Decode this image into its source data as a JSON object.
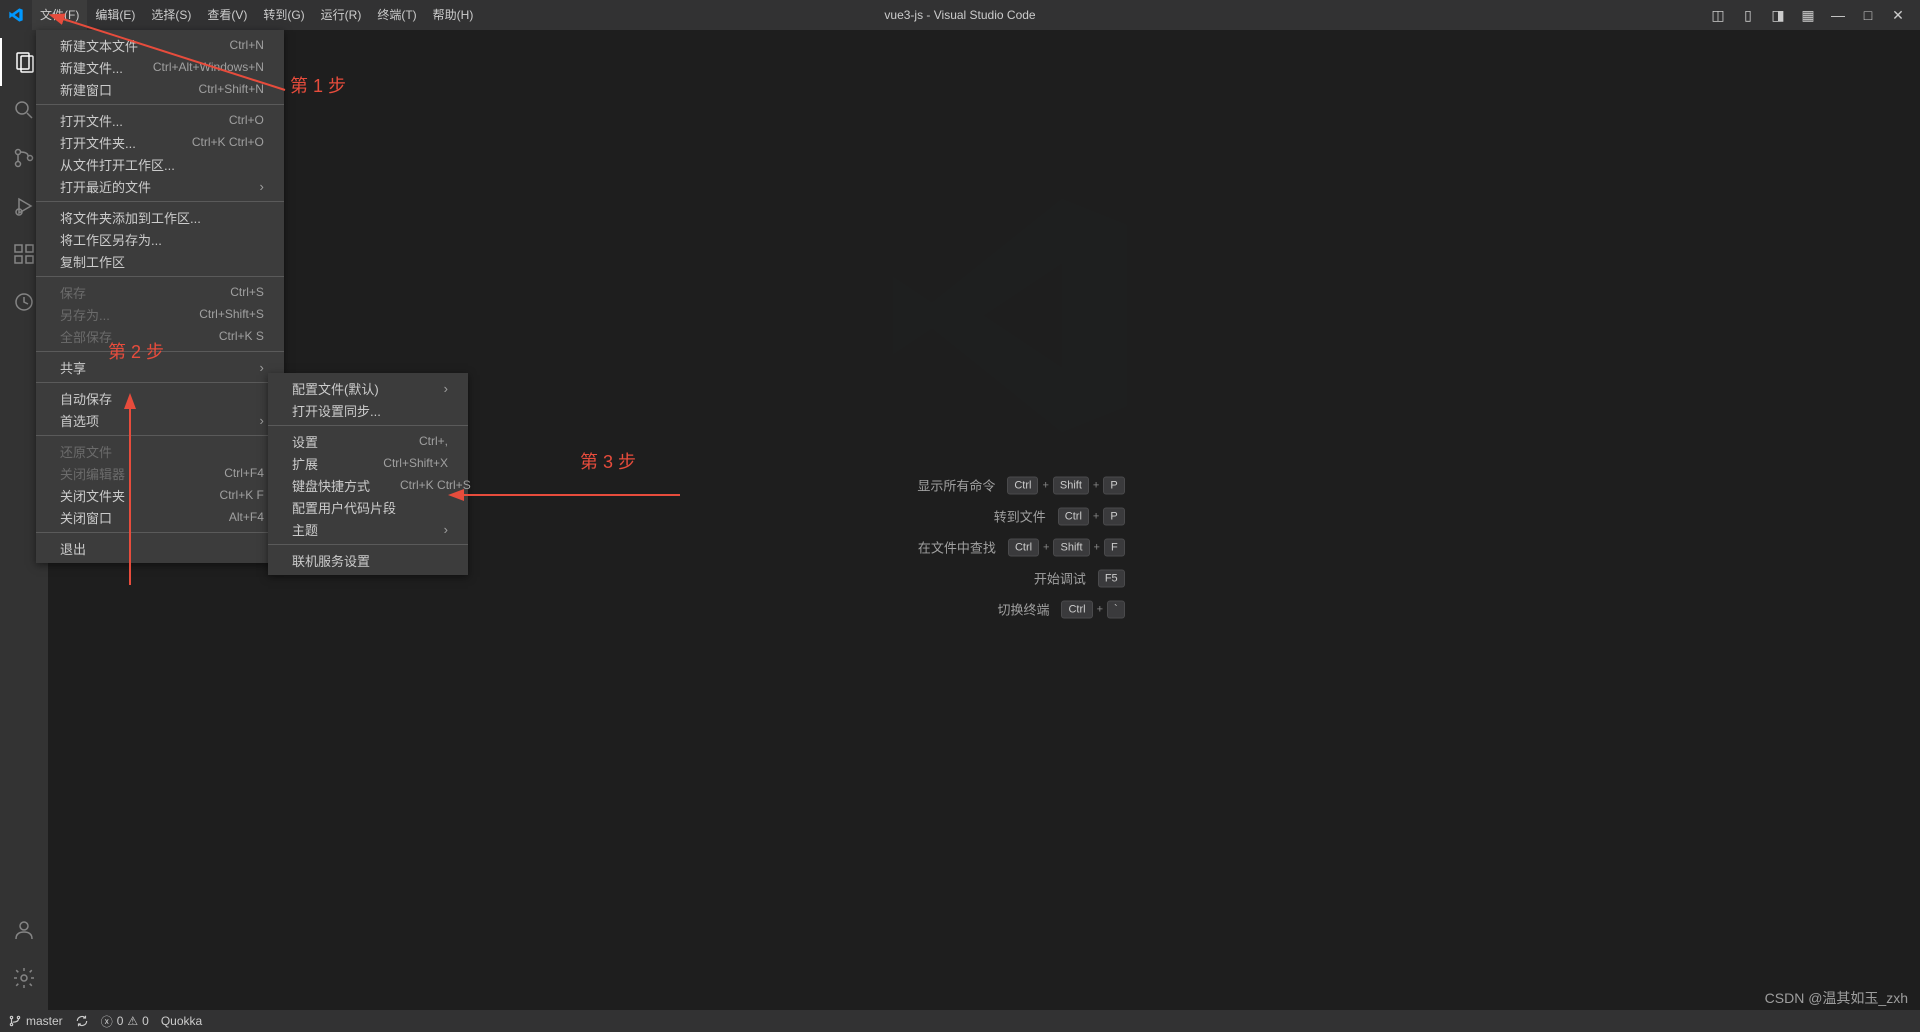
{
  "title": "vue3-js - Visual Studio Code",
  "menubar": [
    "文件(F)",
    "编辑(E)",
    "选择(S)",
    "查看(V)",
    "转到(G)",
    "运行(R)",
    "终端(T)",
    "帮助(H)"
  ],
  "fileMenu": {
    "g1": [
      {
        "label": "新建文本文件",
        "sc": "Ctrl+N"
      },
      {
        "label": "新建文件...",
        "sc": "Ctrl+Alt+Windows+N"
      },
      {
        "label": "新建窗口",
        "sc": "Ctrl+Shift+N"
      }
    ],
    "g2": [
      {
        "label": "打开文件...",
        "sc": "Ctrl+O"
      },
      {
        "label": "打开文件夹...",
        "sc": "Ctrl+K Ctrl+O"
      },
      {
        "label": "从文件打开工作区...",
        "sc": ""
      },
      {
        "label": "打开最近的文件",
        "sc": "",
        "sub": true
      }
    ],
    "g3": [
      {
        "label": "将文件夹添加到工作区...",
        "sc": ""
      },
      {
        "label": "将工作区另存为...",
        "sc": ""
      },
      {
        "label": "复制工作区",
        "sc": ""
      }
    ],
    "g4": [
      {
        "label": "保存",
        "sc": "Ctrl+S",
        "disabled": true
      },
      {
        "label": "另存为...",
        "sc": "Ctrl+Shift+S",
        "disabled": true
      },
      {
        "label": "全部保存",
        "sc": "Ctrl+K S",
        "disabled": true
      }
    ],
    "g5": [
      {
        "label": "共享",
        "sc": "",
        "sub": true
      }
    ],
    "g6": [
      {
        "label": "自动保存",
        "sc": ""
      },
      {
        "label": "首选项",
        "sc": "",
        "sub": true
      }
    ],
    "g7": [
      {
        "label": "还原文件",
        "sc": "",
        "disabled": true
      },
      {
        "label": "关闭编辑器",
        "sc": "Ctrl+F4",
        "disabled": true
      },
      {
        "label": "关闭文件夹",
        "sc": "Ctrl+K F"
      },
      {
        "label": "关闭窗口",
        "sc": "Alt+F4"
      }
    ],
    "g8": [
      {
        "label": "退出",
        "sc": ""
      }
    ]
  },
  "prefsMenu": {
    "g1": [
      {
        "label": "配置文件(默认)",
        "sc": "",
        "sub": true
      },
      {
        "label": "打开设置同步...",
        "sc": ""
      }
    ],
    "g2": [
      {
        "label": "设置",
        "sc": "Ctrl+,"
      },
      {
        "label": "扩展",
        "sc": "Ctrl+Shift+X"
      },
      {
        "label": "键盘快捷方式",
        "sc": "Ctrl+K Ctrl+S"
      },
      {
        "label": "配置用户代码片段",
        "sc": ""
      },
      {
        "label": "主题",
        "sc": "",
        "sub": true
      }
    ],
    "g3": [
      {
        "label": "联机服务设置",
        "sc": ""
      }
    ]
  },
  "welcomeShortcuts": [
    {
      "label": "显示所有命令",
      "keys": [
        "Ctrl",
        "Shift",
        "P"
      ]
    },
    {
      "label": "转到文件",
      "keys": [
        "Ctrl",
        "P"
      ]
    },
    {
      "label": "在文件中查找",
      "keys": [
        "Ctrl",
        "Shift",
        "F"
      ]
    },
    {
      "label": "开始调试",
      "keys": [
        "F5"
      ]
    },
    {
      "label": "切换终端",
      "keys": [
        "Ctrl",
        "`"
      ]
    }
  ],
  "status": {
    "branch": "master",
    "errors": "0",
    "warnings": "0",
    "quokka": "Quokka"
  },
  "annotations": {
    "step1": "第 1 步",
    "step2": "第 2 步",
    "step3": "第 3 步"
  },
  "watermark": "CSDN @温其如玉_zxh"
}
